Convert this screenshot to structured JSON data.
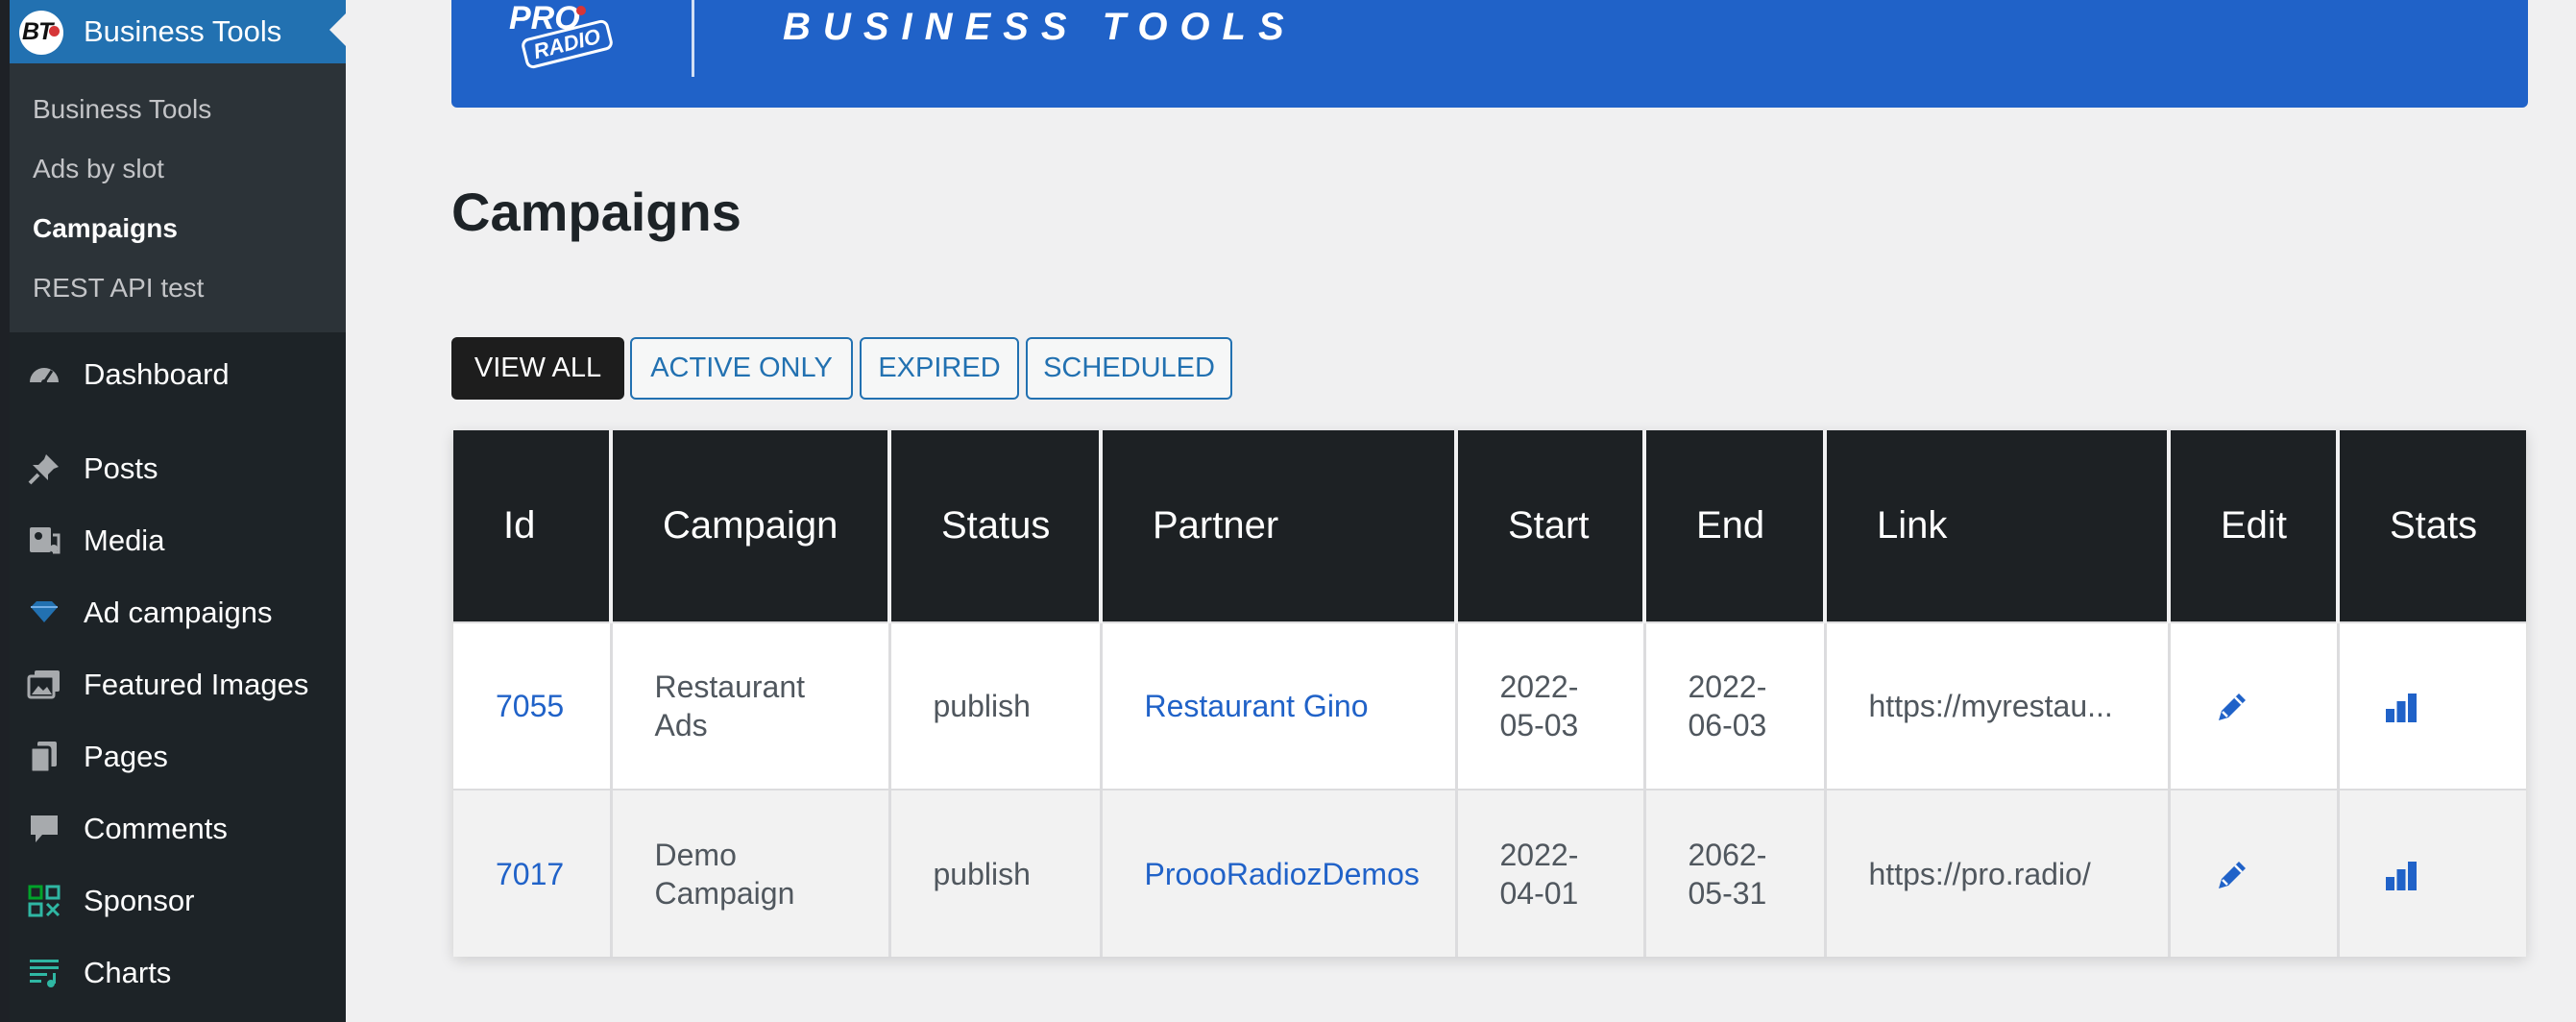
{
  "sidebar": {
    "header_title": "Business Tools",
    "logo_text": "BT",
    "submenu": [
      "Business Tools",
      "Ads by slot",
      "Campaigns",
      "REST API test"
    ],
    "menu": [
      {
        "label": "Dashboard",
        "icon": "dashboard-icon"
      },
      {
        "label": "Posts",
        "icon": "pushpin-icon"
      },
      {
        "label": "Media",
        "icon": "media-icon"
      },
      {
        "label": "Ad campaigns",
        "icon": "diamond-icon"
      },
      {
        "label": "Featured Images",
        "icon": "images-icon"
      },
      {
        "label": "Pages",
        "icon": "pages-icon"
      },
      {
        "label": "Comments",
        "icon": "comment-icon"
      },
      {
        "label": "Sponsor",
        "icon": "qr-icon"
      },
      {
        "label": "Charts",
        "icon": "playlist-icon"
      }
    ]
  },
  "banner": {
    "logo_top": "PRO",
    "logo_bottom": "RADIO",
    "title": "BUSINESS TOOLS"
  },
  "page": {
    "title": "Campaigns",
    "filters": [
      "VIEW ALL",
      "ACTIVE ONLY",
      "EXPIRED",
      "SCHEDULED"
    ],
    "active_filter": "VIEW ALL"
  },
  "table": {
    "columns": [
      "Id",
      "Campaign",
      "Status",
      "Partner",
      "Start",
      "End",
      "Link",
      "Edit",
      "Stats"
    ],
    "rows": [
      {
        "id": "7055",
        "campaign_l1": "Restaurant",
        "campaign_l2": "Ads",
        "status": "publish",
        "partner": "Restaurant Gino",
        "start_l1": "2022-",
        "start_l2": "05-03",
        "end_l1": "2022-",
        "end_l2": "06-03",
        "link": "https://myrestau..."
      },
      {
        "id": "7017",
        "campaign_l1": "Demo",
        "campaign_l2": "Campaign",
        "status": "publish",
        "partner": "ProooRadiozDemos",
        "start_l1": "2022-",
        "start_l2": "04-01",
        "end_l1": "2062-",
        "end_l2": "05-31",
        "link": "https://pro.radio/"
      }
    ]
  },
  "colors": {
    "accent_blue": "#2062c8",
    "sidebar_dark": "#1d2327",
    "header_dark": "#1d2124"
  }
}
